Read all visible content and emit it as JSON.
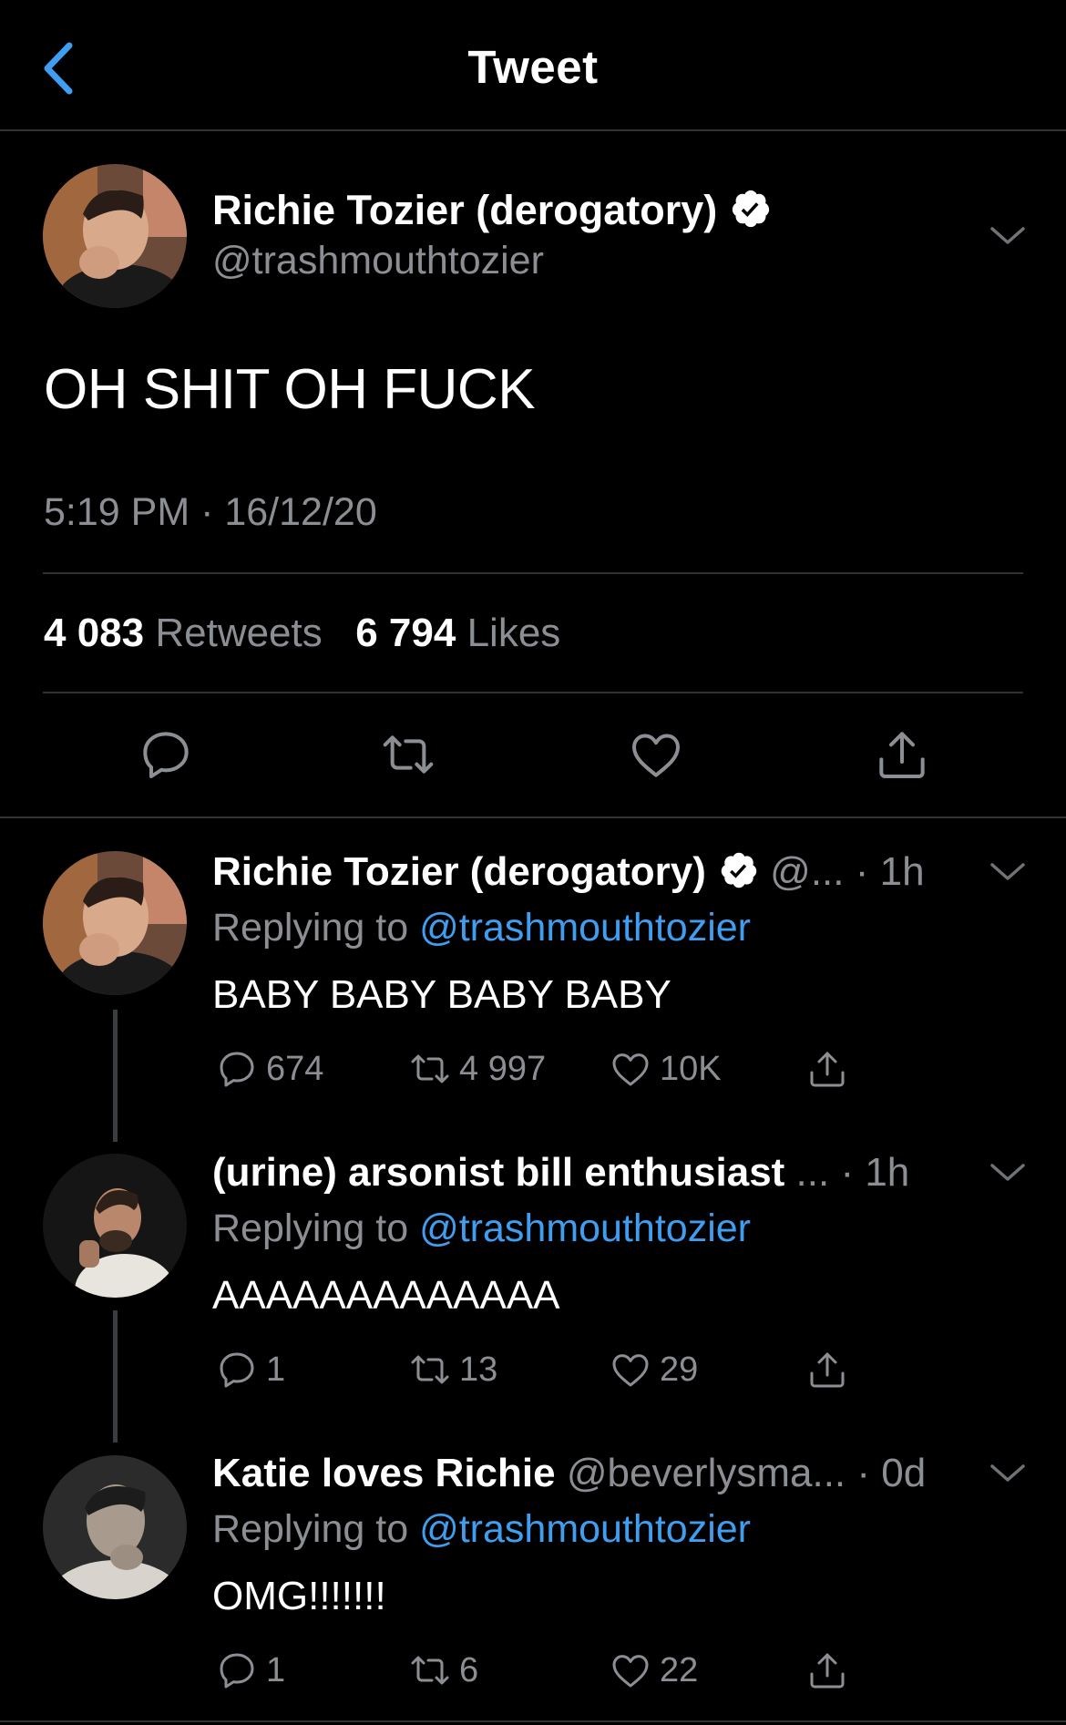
{
  "header": {
    "title": "Tweet"
  },
  "main_tweet": {
    "author_name": "Richie Tozier (derogatory)",
    "handle": "@trashmouthtozier",
    "text": "OH SHIT OH FUCK",
    "timestamp": "5:19 PM · 16/12/20",
    "retweets_count": "4 083",
    "retweets_label": "Retweets",
    "likes_count": "6 794",
    "likes_label": "Likes"
  },
  "replies": [
    {
      "author_name": "Richie Tozier (derogatory)",
      "meta": "@... · 1h",
      "verified": true,
      "replying_prefix": "Replying to ",
      "replying_to": "@trashmouthtozier",
      "text": "BABY BABY BABY BABY",
      "reply_count": "674",
      "retweet_count": "4 997",
      "like_count": "10K"
    },
    {
      "author_name": "(urine) arsonist bill enthusiast",
      "meta": " ... · 1h",
      "verified": false,
      "replying_prefix": "Replying to ",
      "replying_to": "@trashmouthtozier",
      "text": "AAAAAAAAAAAAA",
      "reply_count": "1",
      "retweet_count": "13",
      "like_count": "29"
    },
    {
      "author_name": "Katie loves Richie",
      "meta": " @beverlysma... · 0d",
      "verified": false,
      "replying_prefix": "Replying to ",
      "replying_to": "@trashmouthtozier",
      "text": "OMG!!!!!!!",
      "reply_count": "1",
      "retweet_count": "6",
      "like_count": "22"
    }
  ],
  "colors": {
    "background": "#000000",
    "accent": "#3f9ef0",
    "muted_text": "#8b8f94",
    "divider": "#2f3336"
  },
  "icons": {
    "back": "chevron-left-icon",
    "verified": "verified-badge-icon",
    "more": "chevron-down-icon",
    "reply": "comment-icon",
    "retweet": "retweet-icon",
    "like": "heart-icon",
    "share": "share-icon"
  }
}
